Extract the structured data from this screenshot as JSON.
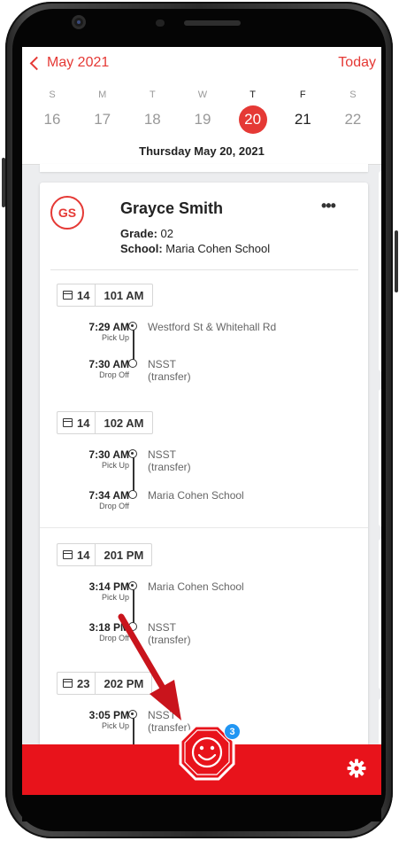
{
  "header": {
    "month_label": "May 2021",
    "today_label": "Today",
    "date_title": "Thursday May 20, 2021",
    "week": [
      {
        "dow": "S",
        "num": "16"
      },
      {
        "dow": "M",
        "num": "17"
      },
      {
        "dow": "T",
        "num": "18"
      },
      {
        "dow": "W",
        "num": "19"
      },
      {
        "dow": "T",
        "num": "20"
      },
      {
        "dow": "F",
        "num": "21"
      },
      {
        "dow": "S",
        "num": "22"
      }
    ]
  },
  "student": {
    "initials": "GS",
    "name": "Grayce Smith",
    "grade_label": "Grade:",
    "grade": "02",
    "school_label": "School:",
    "school": "Maria Cohen School",
    "more": "•••"
  },
  "routes": [
    {
      "bus": "14",
      "name": "101 AM",
      "stops": [
        {
          "time": "7:29 AM",
          "type": "Pick Up",
          "location": "Westford St & Whitehall Rd",
          "sub": ""
        },
        {
          "time": "7:30 AM",
          "type": "Drop Off",
          "location": "NSST",
          "sub": "(transfer)"
        }
      ]
    },
    {
      "bus": "14",
      "name": "102 AM",
      "stops": [
        {
          "time": "7:30 AM",
          "type": "Pick Up",
          "location": "NSST",
          "sub": "(transfer)"
        },
        {
          "time": "7:34 AM",
          "type": "Drop Off",
          "location": "Maria Cohen School",
          "sub": ""
        }
      ]
    },
    {
      "bus": "14",
      "name": "201 PM",
      "stops": [
        {
          "time": "3:14 PM",
          "type": "Pick Up",
          "location": "Maria Cohen School",
          "sub": ""
        },
        {
          "time": "3:18 PM",
          "type": "Drop Off",
          "location": "NSST",
          "sub": "(transfer)"
        }
      ]
    },
    {
      "bus": "23",
      "name": "202 PM",
      "stops": [
        {
          "time": "3:05 PM",
          "type": "Pick Up",
          "location": "NSST",
          "sub": "(transfer)"
        }
      ]
    }
  ],
  "bottom_bar": {
    "notification_count": "3"
  },
  "colors": {
    "accent": "#e53935",
    "bottom_bar": "#e8131b",
    "badge": "#2196f3"
  }
}
